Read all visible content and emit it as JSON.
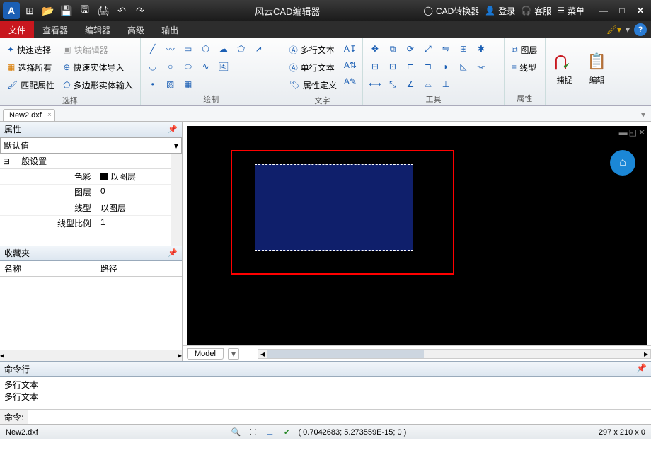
{
  "app": {
    "title": "风云CAD编辑器"
  },
  "titlebar_links": {
    "converter": "CAD转换器",
    "login": "登录",
    "support": "客服",
    "menu": "菜单"
  },
  "tabs": {
    "file": "文件",
    "viewer": "查看器",
    "editor": "编辑器",
    "advanced": "高级",
    "output": "输出"
  },
  "ribbon": {
    "select": {
      "quick": "快速选择",
      "all": "选择所有",
      "match": "匹配属性",
      "blockedit": "块编辑器",
      "quickimport": "快速实体导入",
      "polyinput": "多边形实体输入",
      "label": "选择"
    },
    "draw_label": "绘制",
    "text": {
      "mtext": "多行文本",
      "stext": "单行文本",
      "attdef": "属性定义",
      "label": "文字"
    },
    "tools_label": "工具",
    "props": {
      "layer": "图层",
      "linetype": "线型",
      "label": "属性"
    },
    "snap": "捕捉",
    "edit": "编辑"
  },
  "doc": {
    "name": "New2.dxf"
  },
  "properties": {
    "panel_title": "属性",
    "default": "默认值",
    "cat_general": "一般设置",
    "rows": {
      "color_k": "色彩",
      "color_v": "以图层",
      "layer_k": "图层",
      "layer_v": "0",
      "ltype_k": "线型",
      "ltype_v": "以图层",
      "lscale_k": "线型比例",
      "lscale_v": "1"
    }
  },
  "favorites": {
    "title": "收藏夹",
    "col_name": "名称",
    "col_path": "路径"
  },
  "model_tab": "Model",
  "command": {
    "title": "命令行",
    "history1": "多行文本",
    "history2": "多行文本",
    "prompt": "命令:"
  },
  "status": {
    "file": "New2.dxf",
    "coords": "( 0.7042683; 5.273559E-15; 0 )",
    "dims": "297 x 210 x 0"
  }
}
